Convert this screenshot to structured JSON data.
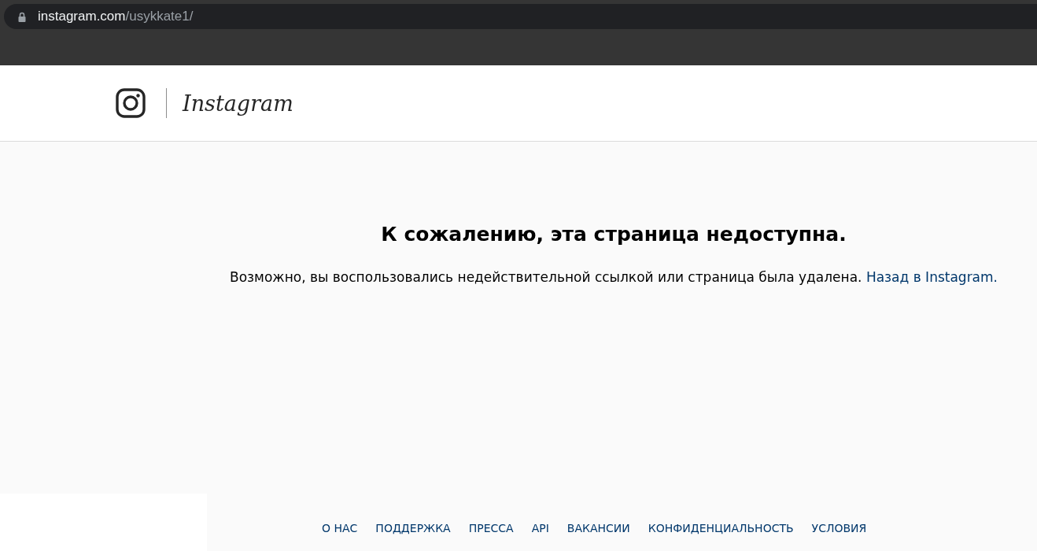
{
  "browser": {
    "url_host": "instagram.com",
    "url_path": "/usykkate1/"
  },
  "header": {
    "wordmark": "Instagram"
  },
  "error": {
    "title": "К сожалению, эта страница недоступна.",
    "message": "Возможно, вы воспользовались недействительной ссылкой или страница была удалена.",
    "link": "Назад в Instagram."
  },
  "footer": {
    "links": [
      "О НАС",
      "ПОДДЕРЖКА",
      "ПРЕССА",
      "API",
      "ВАКАНСИИ",
      "КОНФИДЕНЦИАЛЬНОСТЬ",
      "УСЛОВИЯ"
    ]
  }
}
